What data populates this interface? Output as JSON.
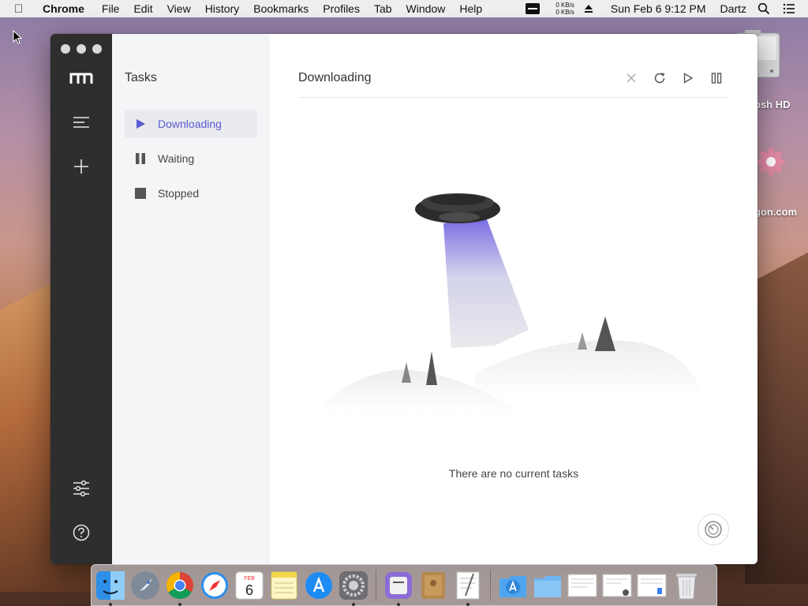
{
  "menubar": {
    "app_name": "Chrome",
    "menus": [
      "File",
      "Edit",
      "View",
      "History",
      "Bookmarks",
      "Profiles",
      "Tab",
      "Window",
      "Help"
    ],
    "net_up": "0 KB/s",
    "net_down": "0 KB/s",
    "clock": "Sun Feb 6  9:12 PM",
    "user": "Dartz"
  },
  "desktop": {
    "disk_label": "osh HD",
    "url_label": "gon.com"
  },
  "sidebar": {
    "title": "Tasks",
    "items": [
      {
        "label": "Downloading",
        "icon": "play-icon"
      },
      {
        "label": "Waiting",
        "icon": "pause-icon"
      },
      {
        "label": "Stopped",
        "icon": "stop-icon"
      }
    ]
  },
  "main": {
    "title": "Downloading",
    "empty_text": "There are no current tasks"
  },
  "dock": {
    "calendar_month": "FEB",
    "calendar_day": "6"
  },
  "colors": {
    "accent": "#5b5bd6",
    "rail": "#2e2e2f",
    "sidebar": "#f4f5f7"
  }
}
